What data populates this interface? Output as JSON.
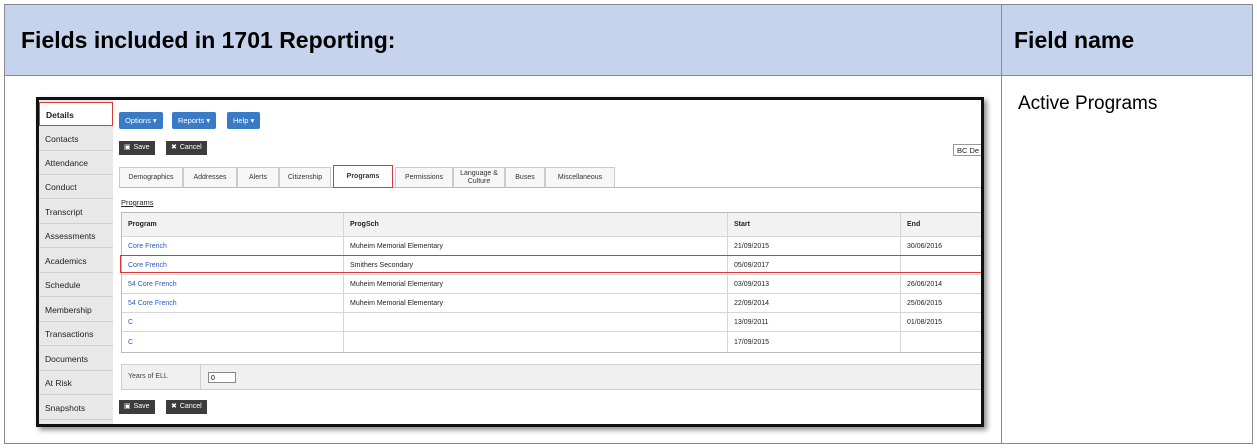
{
  "doc": {
    "header_left": "Fields included in 1701 Reporting:",
    "header_right": "Field name",
    "field_value": "Active Programs"
  },
  "app": {
    "sidebar": [
      {
        "label": "Details",
        "active": true
      },
      {
        "label": "Contacts"
      },
      {
        "label": "Attendance"
      },
      {
        "label": "Conduct"
      },
      {
        "label": "Transcript"
      },
      {
        "label": "Assessments"
      },
      {
        "label": "Academics"
      },
      {
        "label": "Schedule"
      },
      {
        "label": "Membership"
      },
      {
        "label": "Transactions"
      },
      {
        "label": "Documents"
      },
      {
        "label": "At Risk"
      },
      {
        "label": "Snapshots"
      }
    ],
    "menus": {
      "options": "Options ▾",
      "reports": "Reports ▾",
      "help": "Help ▾"
    },
    "save_label": "Save",
    "cancel_label": "Cancel",
    "bc_label": "BC De",
    "tabs": [
      "Demographics",
      "Addresses",
      "Alerts",
      "Citizenship",
      "Programs",
      "Permissions",
      "Language & Culture",
      "Buses",
      "Miscellaneous"
    ],
    "active_tab": "Programs",
    "programs_link": "Programs",
    "table": {
      "columns": [
        "Program",
        "ProgSch",
        "Start",
        "End"
      ],
      "rows": [
        {
          "program": "Core French",
          "progsch": "Muheim Memorial Elementary",
          "start": "21/09/2015",
          "end": "30/06/2016"
        },
        {
          "program": "Core French",
          "progsch": "Smithers Secondary",
          "start": "05/09/2017",
          "end": "",
          "highlighted": true
        },
        {
          "program": "54 Core French",
          "progsch": "Muheim Memorial Elementary",
          "start": "03/09/2013",
          "end": "26/06/2014"
        },
        {
          "program": "54 Core French",
          "progsch": "Muheim Memorial Elementary",
          "start": "22/09/2014",
          "end": "25/06/2015"
        },
        {
          "program": "C",
          "progsch": "",
          "start": "13/09/2011",
          "end": "01/08/2015"
        },
        {
          "program": "C",
          "progsch": "",
          "start": "17/09/2015",
          "end": ""
        }
      ]
    },
    "ell_label": "Years of ELL",
    "ell_value": "0"
  },
  "colors": {
    "header_bg": "#c5d3ec",
    "accent_blue": "#3a7bc8",
    "highlight_red": "#d9383a"
  }
}
